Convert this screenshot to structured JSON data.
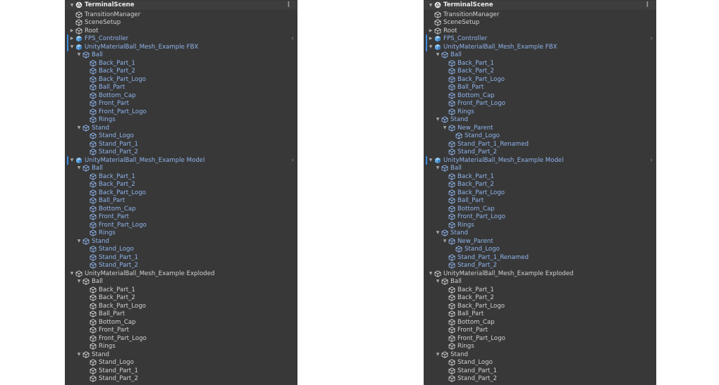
{
  "panels": [
    {
      "scene": "TerminalScene",
      "nodes": [
        {
          "label": "TransitionManager",
          "depth": 1,
          "arrow": "",
          "kind": "go",
          "color": "white"
        },
        {
          "label": "SceneSetup",
          "depth": 1,
          "arrow": "",
          "kind": "go",
          "color": "white"
        },
        {
          "label": "Root",
          "depth": 1,
          "arrow": "collapsed",
          "kind": "go",
          "color": "white"
        },
        {
          "label": "FPS_Controller",
          "depth": 1,
          "arrow": "collapsed",
          "kind": "prefab",
          "color": "blue",
          "mark": true,
          "chevron": true
        },
        {
          "label": "UnityMaterialBall_Mesh_Example FBX",
          "depth": 1,
          "arrow": "expanded",
          "kind": "prefab",
          "color": "blue",
          "mark": true
        },
        {
          "label": "Ball",
          "depth": 2,
          "arrow": "expanded",
          "kind": "go",
          "color": "blue"
        },
        {
          "label": "Back_Part_1",
          "depth": 3,
          "arrow": "",
          "kind": "go",
          "color": "blue"
        },
        {
          "label": "Back_Part_2",
          "depth": 3,
          "arrow": "",
          "kind": "go",
          "color": "blue"
        },
        {
          "label": "Back_Part_Logo",
          "depth": 3,
          "arrow": "",
          "kind": "go",
          "color": "blue"
        },
        {
          "label": "Ball_Part",
          "depth": 3,
          "arrow": "",
          "kind": "go",
          "color": "blue"
        },
        {
          "label": "Bottom_Cap",
          "depth": 3,
          "arrow": "",
          "kind": "go",
          "color": "blue"
        },
        {
          "label": "Front_Part",
          "depth": 3,
          "arrow": "",
          "kind": "go",
          "color": "blue"
        },
        {
          "label": "Front_Part_Logo",
          "depth": 3,
          "arrow": "",
          "kind": "go",
          "color": "blue"
        },
        {
          "label": "Rings",
          "depth": 3,
          "arrow": "",
          "kind": "go",
          "color": "blue"
        },
        {
          "label": "Stand",
          "depth": 2,
          "arrow": "expanded",
          "kind": "go",
          "color": "blue"
        },
        {
          "label": "Stand_Logo",
          "depth": 3,
          "arrow": "",
          "kind": "go",
          "color": "blue"
        },
        {
          "label": "Stand_Part_1",
          "depth": 3,
          "arrow": "",
          "kind": "go",
          "color": "blue"
        },
        {
          "label": "Stand_Part_2",
          "depth": 3,
          "arrow": "",
          "kind": "go",
          "color": "blue"
        },
        {
          "label": "UnityMaterialBall_Mesh_Example Model",
          "depth": 1,
          "arrow": "expanded",
          "kind": "prefab",
          "color": "blue",
          "mark": true,
          "chevron": true
        },
        {
          "label": "Ball",
          "depth": 2,
          "arrow": "expanded",
          "kind": "go",
          "color": "blue"
        },
        {
          "label": "Back_Part_1",
          "depth": 3,
          "arrow": "",
          "kind": "go",
          "color": "blue"
        },
        {
          "label": "Back_Part_2",
          "depth": 3,
          "arrow": "",
          "kind": "go",
          "color": "blue"
        },
        {
          "label": "Back_Part_Logo",
          "depth": 3,
          "arrow": "",
          "kind": "go",
          "color": "blue"
        },
        {
          "label": "Ball_Part",
          "depth": 3,
          "arrow": "",
          "kind": "go",
          "color": "blue"
        },
        {
          "label": "Bottom_Cap",
          "depth": 3,
          "arrow": "",
          "kind": "go",
          "color": "blue"
        },
        {
          "label": "Front_Part",
          "depth": 3,
          "arrow": "",
          "kind": "go",
          "color": "blue"
        },
        {
          "label": "Front_Part_Logo",
          "depth": 3,
          "arrow": "",
          "kind": "go",
          "color": "blue"
        },
        {
          "label": "Rings",
          "depth": 3,
          "arrow": "",
          "kind": "go",
          "color": "blue"
        },
        {
          "label": "Stand",
          "depth": 2,
          "arrow": "expanded",
          "kind": "go",
          "color": "blue"
        },
        {
          "label": "Stand_Logo",
          "depth": 3,
          "arrow": "",
          "kind": "go",
          "color": "blue"
        },
        {
          "label": "Stand_Part_1",
          "depth": 3,
          "arrow": "",
          "kind": "go",
          "color": "blue"
        },
        {
          "label": "Stand_Part_2",
          "depth": 3,
          "arrow": "",
          "kind": "go",
          "color": "blue"
        },
        {
          "label": "UnityMaterialBall_Mesh_Example Exploded",
          "depth": 1,
          "arrow": "expanded",
          "kind": "go",
          "color": "white"
        },
        {
          "label": "Ball",
          "depth": 2,
          "arrow": "expanded",
          "kind": "go",
          "color": "white"
        },
        {
          "label": "Back_Part_1",
          "depth": 3,
          "arrow": "",
          "kind": "go",
          "color": "white"
        },
        {
          "label": "Back_Part_2",
          "depth": 3,
          "arrow": "",
          "kind": "go",
          "color": "white"
        },
        {
          "label": "Back_Part_Logo",
          "depth": 3,
          "arrow": "",
          "kind": "go",
          "color": "white"
        },
        {
          "label": "Ball_Part",
          "depth": 3,
          "arrow": "",
          "kind": "go",
          "color": "white"
        },
        {
          "label": "Bottom_Cap",
          "depth": 3,
          "arrow": "",
          "kind": "go",
          "color": "white"
        },
        {
          "label": "Front_Part",
          "depth": 3,
          "arrow": "",
          "kind": "go",
          "color": "white"
        },
        {
          "label": "Front_Part_Logo",
          "depth": 3,
          "arrow": "",
          "kind": "go",
          "color": "white"
        },
        {
          "label": "Rings",
          "depth": 3,
          "arrow": "",
          "kind": "go",
          "color": "white"
        },
        {
          "label": "Stand",
          "depth": 2,
          "arrow": "expanded",
          "kind": "go",
          "color": "white"
        },
        {
          "label": "Stand_Logo",
          "depth": 3,
          "arrow": "",
          "kind": "go",
          "color": "white"
        },
        {
          "label": "Stand_Part_1",
          "depth": 3,
          "arrow": "",
          "kind": "go",
          "color": "white"
        },
        {
          "label": "Stand_Part_2",
          "depth": 3,
          "arrow": "",
          "kind": "go",
          "color": "white"
        }
      ]
    },
    {
      "scene": "TerminalScene",
      "nodes": [
        {
          "label": "TransitionManager",
          "depth": 1,
          "arrow": "",
          "kind": "go",
          "color": "white"
        },
        {
          "label": "SceneSetup",
          "depth": 1,
          "arrow": "",
          "kind": "go",
          "color": "white"
        },
        {
          "label": "Root",
          "depth": 1,
          "arrow": "collapsed",
          "kind": "go",
          "color": "white"
        },
        {
          "label": "FPS_Controller",
          "depth": 1,
          "arrow": "collapsed",
          "kind": "prefab",
          "color": "blue",
          "mark": true,
          "chevron": true
        },
        {
          "label": "UnityMaterialBall_Mesh_Example FBX",
          "depth": 1,
          "arrow": "expanded",
          "kind": "prefab",
          "color": "blue",
          "mark": true
        },
        {
          "label": "Ball",
          "depth": 2,
          "arrow": "expanded",
          "kind": "go",
          "color": "blue"
        },
        {
          "label": "Back_Part_1",
          "depth": 3,
          "arrow": "",
          "kind": "go",
          "color": "blue"
        },
        {
          "label": "Back_Part_2",
          "depth": 3,
          "arrow": "",
          "kind": "go",
          "color": "blue"
        },
        {
          "label": "Back_Part_Logo",
          "depth": 3,
          "arrow": "",
          "kind": "go",
          "color": "blue"
        },
        {
          "label": "Ball_Part",
          "depth": 3,
          "arrow": "",
          "kind": "go",
          "color": "blue"
        },
        {
          "label": "Bottom_Cap",
          "depth": 3,
          "arrow": "",
          "kind": "go",
          "color": "blue"
        },
        {
          "label": "Front_Part_Logo",
          "depth": 3,
          "arrow": "",
          "kind": "go",
          "color": "blue"
        },
        {
          "label": "Rings",
          "depth": 3,
          "arrow": "",
          "kind": "go",
          "color": "blue"
        },
        {
          "label": "Stand",
          "depth": 2,
          "arrow": "expanded",
          "kind": "go",
          "color": "blue"
        },
        {
          "label": "New_Parent",
          "depth": 3,
          "arrow": "expanded",
          "kind": "go",
          "color": "blue"
        },
        {
          "label": "Stand_Logo",
          "depth": 4,
          "arrow": "",
          "kind": "go",
          "color": "blue"
        },
        {
          "label": "Stand_Part_1_Renamed",
          "depth": 3,
          "arrow": "",
          "kind": "go",
          "color": "blue"
        },
        {
          "label": "Stand_Part_2",
          "depth": 3,
          "arrow": "",
          "kind": "go",
          "color": "blue"
        },
        {
          "label": "UnityMaterialBall_Mesh_Example Model",
          "depth": 1,
          "arrow": "expanded",
          "kind": "prefab",
          "color": "blue",
          "mark": true,
          "chevron": true
        },
        {
          "label": "Ball",
          "depth": 2,
          "arrow": "expanded",
          "kind": "go",
          "color": "blue"
        },
        {
          "label": "Back_Part_1",
          "depth": 3,
          "arrow": "",
          "kind": "go",
          "color": "blue"
        },
        {
          "label": "Back_Part_2",
          "depth": 3,
          "arrow": "",
          "kind": "go",
          "color": "blue"
        },
        {
          "label": "Back_Part_Logo",
          "depth": 3,
          "arrow": "",
          "kind": "go",
          "color": "blue"
        },
        {
          "label": "Ball_Part",
          "depth": 3,
          "arrow": "",
          "kind": "go",
          "color": "blue"
        },
        {
          "label": "Bottom_Cap",
          "depth": 3,
          "arrow": "",
          "kind": "go",
          "color": "blue"
        },
        {
          "label": "Front_Part_Logo",
          "depth": 3,
          "arrow": "",
          "kind": "go",
          "color": "blue"
        },
        {
          "label": "Rings",
          "depth": 3,
          "arrow": "",
          "kind": "go",
          "color": "blue"
        },
        {
          "label": "Stand",
          "depth": 2,
          "arrow": "expanded",
          "kind": "go",
          "color": "blue"
        },
        {
          "label": "New_Parent",
          "depth": 3,
          "arrow": "expanded",
          "kind": "go",
          "color": "blue"
        },
        {
          "label": "Stand_Logo",
          "depth": 4,
          "arrow": "",
          "kind": "go",
          "color": "blue"
        },
        {
          "label": "Stand_Part_1_Renamed",
          "depth": 3,
          "arrow": "",
          "kind": "go",
          "color": "blue"
        },
        {
          "label": "Stand_Part_2",
          "depth": 3,
          "arrow": "",
          "kind": "go",
          "color": "blue"
        },
        {
          "label": "UnityMaterialBall_Mesh_Example Exploded",
          "depth": 1,
          "arrow": "expanded",
          "kind": "go",
          "color": "white"
        },
        {
          "label": "Ball",
          "depth": 2,
          "arrow": "expanded",
          "kind": "go",
          "color": "white"
        },
        {
          "label": "Back_Part_1",
          "depth": 3,
          "arrow": "",
          "kind": "go",
          "color": "white"
        },
        {
          "label": "Back_Part_2",
          "depth": 3,
          "arrow": "",
          "kind": "go",
          "color": "white"
        },
        {
          "label": "Back_Part_Logo",
          "depth": 3,
          "arrow": "",
          "kind": "go",
          "color": "white"
        },
        {
          "label": "Ball_Part",
          "depth": 3,
          "arrow": "",
          "kind": "go",
          "color": "white"
        },
        {
          "label": "Bottom_Cap",
          "depth": 3,
          "arrow": "",
          "kind": "go",
          "color": "white"
        },
        {
          "label": "Front_Part",
          "depth": 3,
          "arrow": "",
          "kind": "go",
          "color": "white"
        },
        {
          "label": "Front_Part_Logo",
          "depth": 3,
          "arrow": "",
          "kind": "go",
          "color": "white"
        },
        {
          "label": "Rings",
          "depth": 3,
          "arrow": "",
          "kind": "go",
          "color": "white"
        },
        {
          "label": "Stand",
          "depth": 2,
          "arrow": "expanded",
          "kind": "go",
          "color": "white"
        },
        {
          "label": "Stand_Logo",
          "depth": 3,
          "arrow": "",
          "kind": "go",
          "color": "white"
        },
        {
          "label": "Stand_Part_1",
          "depth": 3,
          "arrow": "",
          "kind": "go",
          "color": "white"
        },
        {
          "label": "Stand_Part_2",
          "depth": 3,
          "arrow": "",
          "kind": "go",
          "color": "white"
        }
      ]
    }
  ],
  "icons": {
    "scene": "unity-scene-icon",
    "gameobject": "cube-outline-icon",
    "prefab": "prefab-cube-icon",
    "more": "kebab-menu-icon",
    "chevron": "chevron-right-icon",
    "expanded": "expand-arrow-icon",
    "collapsed": "collapse-arrow-icon"
  },
  "colors": {
    "panel_bg": "#383838",
    "header_bg": "#3e3e3e",
    "text_default": "#d2d2d2",
    "text_prefab": "#8fb4ec",
    "prefab_icon": "#63a9e6",
    "override_mark": "#3b8ad9"
  },
  "symbols": {
    "more": "⋮",
    "chevron": "›"
  }
}
